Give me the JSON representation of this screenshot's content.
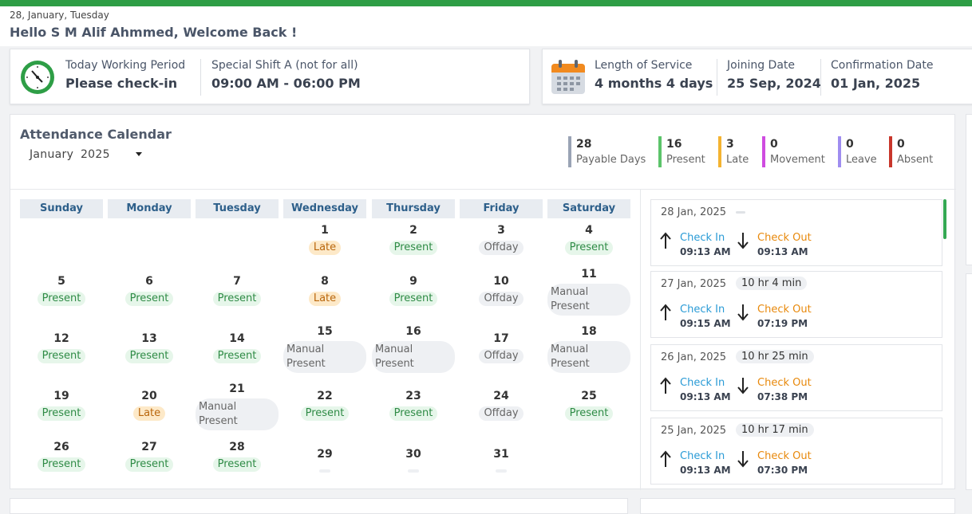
{
  "header": {
    "date": "28, January, Tuesday",
    "welcome": "Hello S M Alif Ahmmed, Welcome Back !"
  },
  "working": {
    "label": "Today Working Period",
    "value": "Please check-in",
    "shift_label": "Special Shift A (not for all)",
    "shift_value": "09:00 AM - 06:00 PM"
  },
  "service": {
    "length_label": "Length of Service",
    "length_value": "4 months 4 days",
    "joining_label": "Joining Date",
    "joining_value": "25 Sep, 2024",
    "confirm_label": "Confirmation Date",
    "confirm_value": "01 Jan, 2025"
  },
  "attendance": {
    "title": "Attendance Calendar",
    "month": "January",
    "year": "2025"
  },
  "summary": [
    {
      "num": "28",
      "label": "Payable Days",
      "color": "#9aa3b5"
    },
    {
      "num": "16",
      "label": "Present",
      "color": "#5cc46a"
    },
    {
      "num": "3",
      "label": "Late",
      "color": "#f4b331"
    },
    {
      "num": "0",
      "label": "Movement",
      "color": "#cf4ce0"
    },
    {
      "num": "0",
      "label": "Leave",
      "color": "#9f8df0"
    },
    {
      "num": "0",
      "label": "Absent",
      "color": "#c8362b"
    }
  ],
  "weekdays": [
    "Sunday",
    "Monday",
    "Tuesday",
    "Wednesday",
    "Thursday",
    "Friday",
    "Saturday"
  ],
  "days": [
    {
      "day": "1",
      "status": "Late",
      "type": "late"
    },
    {
      "day": "2",
      "status": "Present",
      "type": "present"
    },
    {
      "day": "3",
      "status": "Offday",
      "type": "offday"
    },
    {
      "day": "4",
      "status": "Present",
      "type": "present"
    },
    {
      "day": "5",
      "status": "Present",
      "type": "present"
    },
    {
      "day": "6",
      "status": "Present",
      "type": "present"
    },
    {
      "day": "7",
      "status": "Present",
      "type": "present"
    },
    {
      "day": "8",
      "status": "Late",
      "type": "late"
    },
    {
      "day": "9",
      "status": "Present",
      "type": "present"
    },
    {
      "day": "10",
      "status": "Offday",
      "type": "offday"
    },
    {
      "day": "11",
      "status": "Manual Present",
      "type": "manual"
    },
    {
      "day": "12",
      "status": "Present",
      "type": "present"
    },
    {
      "day": "13",
      "status": "Present",
      "type": "present"
    },
    {
      "day": "14",
      "status": "Present",
      "type": "present"
    },
    {
      "day": "15",
      "status": "Manual Present",
      "type": "manual"
    },
    {
      "day": "16",
      "status": "Manual Present",
      "type": "manual"
    },
    {
      "day": "17",
      "status": "Offday",
      "type": "offday"
    },
    {
      "day": "18",
      "status": "Manual Present",
      "type": "manual"
    },
    {
      "day": "19",
      "status": "Present",
      "type": "present"
    },
    {
      "day": "20",
      "status": "Late",
      "type": "late"
    },
    {
      "day": "21",
      "status": "Manual Present",
      "type": "manual"
    },
    {
      "day": "22",
      "status": "Present",
      "type": "present"
    },
    {
      "day": "23",
      "status": "Present",
      "type": "present"
    },
    {
      "day": "24",
      "status": "Offday",
      "type": "offday"
    },
    {
      "day": "25",
      "status": "Present",
      "type": "present"
    },
    {
      "day": "26",
      "status": "Present",
      "type": "present"
    },
    {
      "day": "27",
      "status": "Present",
      "type": "present"
    },
    {
      "day": "28",
      "status": "Present",
      "type": "present"
    },
    {
      "day": "29",
      "status": "",
      "type": "empty"
    },
    {
      "day": "30",
      "status": "",
      "type": "empty"
    },
    {
      "day": "31",
      "status": "",
      "type": "empty"
    }
  ],
  "logs": [
    {
      "date": "28 Jan, 2025",
      "duration": "",
      "in_label": "Check In",
      "in_time": "09:13 AM",
      "out_label": "Check Out",
      "out_time": "09:13 AM"
    },
    {
      "date": "27 Jan, 2025",
      "duration": "10 hr 4 min",
      "in_label": "Check In",
      "in_time": "09:15 AM",
      "out_label": "Check Out",
      "out_time": "07:19 PM"
    },
    {
      "date": "26 Jan, 2025",
      "duration": "10 hr 25 min",
      "in_label": "Check In",
      "in_time": "09:13 AM",
      "out_label": "Check Out",
      "out_time": "07:38 PM"
    },
    {
      "date": "25 Jan, 2025",
      "duration": "10 hr 17 min",
      "in_label": "Check In",
      "in_time": "09:13 AM",
      "out_label": "Check Out",
      "out_time": "07:30 PM"
    }
  ]
}
